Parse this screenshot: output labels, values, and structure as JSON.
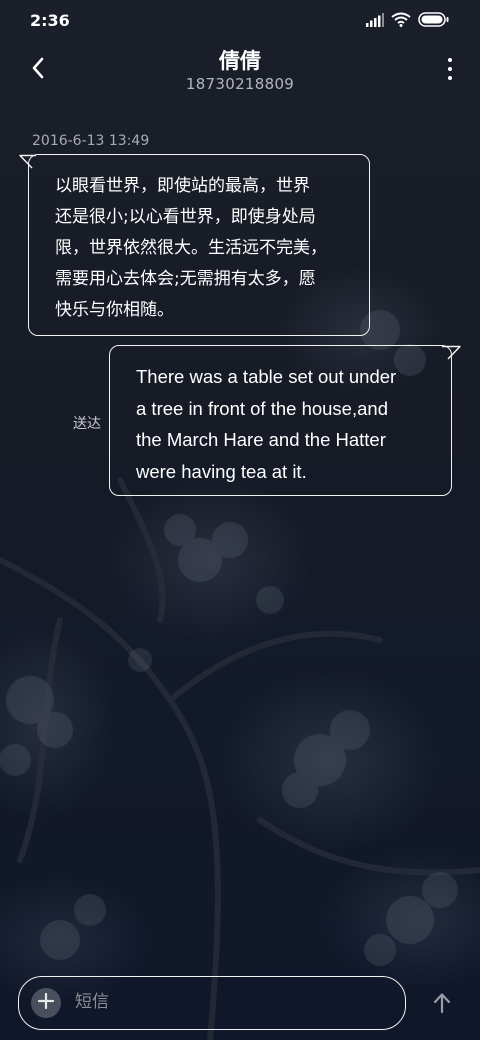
{
  "status_bar": {
    "time": "2:36",
    "icons": [
      "signal-icon",
      "wifi-icon",
      "battery-icon"
    ]
  },
  "header": {
    "title": "倩倩",
    "subtitle": "18730218809",
    "back_icon": "chevron-left-icon",
    "more_icon": "more-vertical-icon"
  },
  "conversation": {
    "timestamp": "2016-6-13 13:49",
    "messages": [
      {
        "direction": "incoming",
        "lines": [
          "以眼看世界，即使站的最高，世界",
          "还是很小;以心看世界，即使身处局",
          "限，世界依然很大。生活远不完美，",
          "需要用心去体会;无需拥有太多，愿",
          "快乐与你相随。"
        ]
      },
      {
        "direction": "outgoing",
        "lines": [
          "There was a table set out under",
          "a tree in front of the house,and",
          "the March Hare and the Hatter",
          "were having tea at it."
        ],
        "status": "送达"
      }
    ]
  },
  "compose": {
    "placeholder": "短信",
    "add_icon": "plus-icon",
    "send_icon": "arrow-up-icon"
  },
  "colors": {
    "bubble_border": "#f2f2f2",
    "secondary_text": "#a8abb2",
    "background": "#141923"
  }
}
